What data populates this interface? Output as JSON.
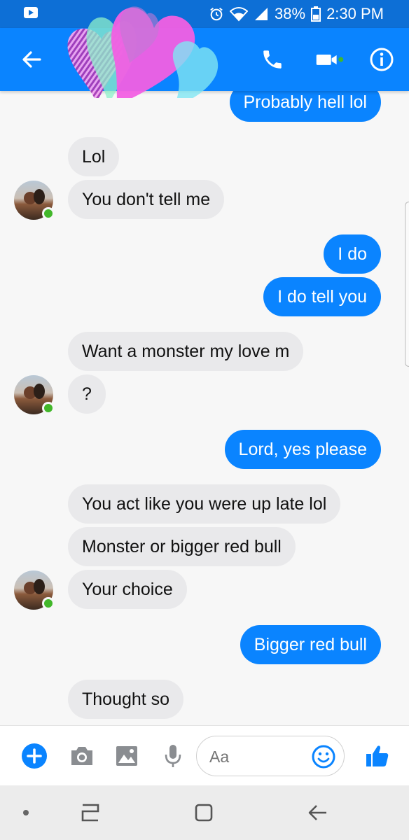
{
  "status_bar": {
    "battery": "38%",
    "time": "2:30 PM"
  },
  "app_bar": {
    "back_icon": "arrow-left-icon",
    "call_icon": "phone-icon",
    "video_icon": "video-camera-icon",
    "info_icon": "info-icon",
    "accent": "#0a84ff"
  },
  "messages": [
    {
      "from": "me",
      "text": "Probably hell lol"
    },
    {
      "from": "them",
      "text": "Lol"
    },
    {
      "from": "them",
      "text": "You don't tell me"
    },
    {
      "from": "me",
      "text": "I do"
    },
    {
      "from": "me",
      "text": "I do tell you"
    },
    {
      "from": "them",
      "text": "Want a monster my love m"
    },
    {
      "from": "them",
      "text": "?"
    },
    {
      "from": "me",
      "text": "Lord, yes please"
    },
    {
      "from": "them",
      "text": "You act like you were up late lol"
    },
    {
      "from": "them",
      "text": "Monster or bigger red bull"
    },
    {
      "from": "them",
      "text": "Your choice"
    },
    {
      "from": "me",
      "text": "Bigger red bull"
    },
    {
      "from": "them",
      "text": "Thought so"
    }
  ],
  "composer": {
    "placeholder": "Aa",
    "icons": [
      "plus-icon",
      "camera-icon",
      "image-icon",
      "microphone-icon",
      "emoji-icon",
      "thumbs-up-icon"
    ]
  },
  "colors": {
    "outgoing_bubble": "#0a84ff",
    "incoming_bubble": "#e9e9eb",
    "online_dot": "#42b72a"
  }
}
